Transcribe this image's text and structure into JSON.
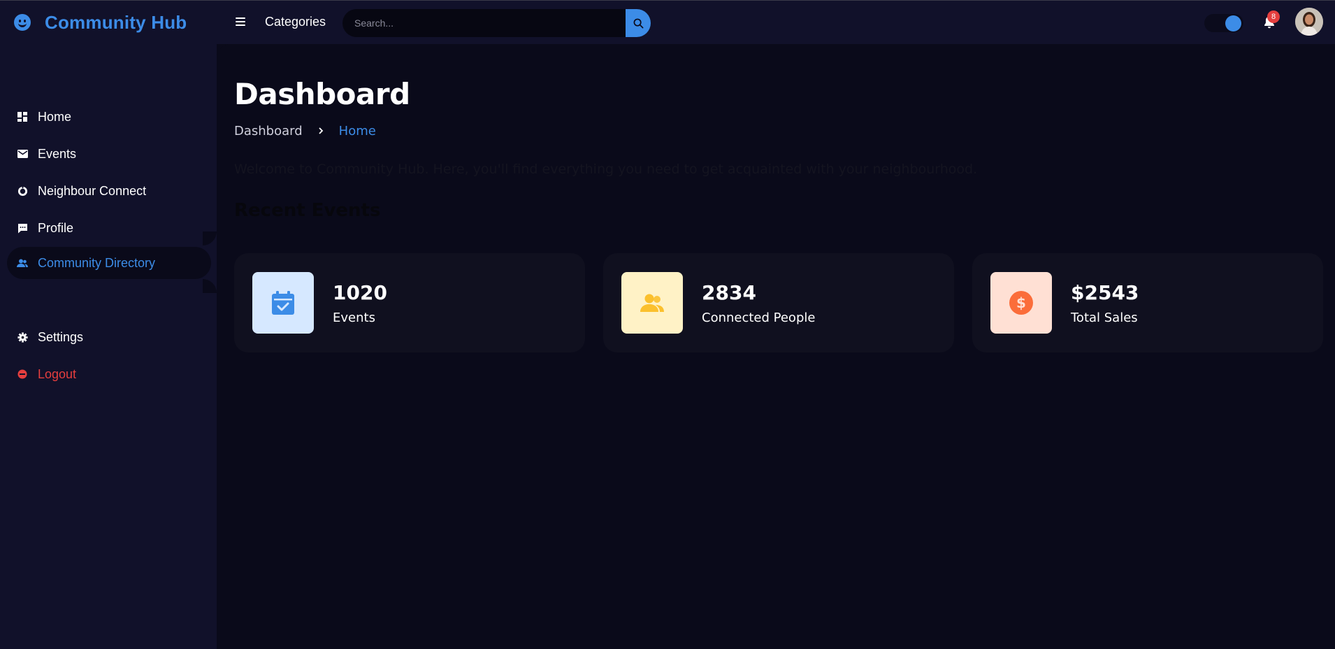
{
  "header": {
    "brand_title": "Community Hub",
    "brand_icon": "smiley-icon",
    "categories_label": "Categories",
    "search_placeholder": "Search...",
    "notification_count": "8",
    "accent_color": "#3c8ce7"
  },
  "sidebar": {
    "items": [
      {
        "label": "Home",
        "icon": "dashboard-grid-icon"
      },
      {
        "label": "Events",
        "icon": "envelope-icon"
      },
      {
        "label": "Neighbour Connect",
        "icon": "donut-chart-icon"
      },
      {
        "label": "Profile",
        "icon": "chat-bubble-icon"
      },
      {
        "label": "Community Directory",
        "icon": "people-icon",
        "active": true
      },
      {
        "label": "Settings",
        "icon": "gear-icon"
      },
      {
        "label": "Logout",
        "icon": "logout-icon"
      }
    ]
  },
  "main": {
    "title": "Dashboard",
    "breadcrumb": [
      "Dashboard",
      "Home"
    ],
    "welcome": "Welcome to Community Hub. Here, you'll find everything you need to get acquainted with your neighbourhood.",
    "section_title": "Recent Events",
    "stats": [
      {
        "value": "1020",
        "label": "Events",
        "icon": "calendar-check-icon",
        "bg": "#d6e8ff",
        "fg": "#3c8ce7"
      },
      {
        "value": "2834",
        "label": "Connected People",
        "icon": "people-icon",
        "bg": "#fff2c6",
        "fg": "#fbc02d"
      },
      {
        "value": "$2543",
        "label": "Total Sales",
        "icon": "dollar-circle-icon",
        "bg": "#ffe0d4",
        "fg": "#fb6d3a"
      }
    ]
  }
}
